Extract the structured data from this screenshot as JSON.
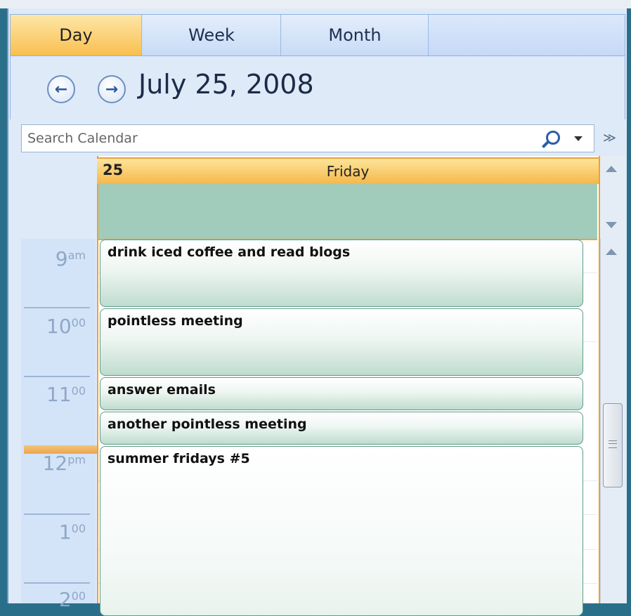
{
  "tabs": [
    {
      "label": "Day",
      "active": true
    },
    {
      "label": "Week",
      "active": false
    },
    {
      "label": "Month",
      "active": false
    }
  ],
  "header": {
    "date_title": "July 25, 2008"
  },
  "search": {
    "placeholder": "Search Calendar"
  },
  "day": {
    "number": "25",
    "name": "Friday"
  },
  "hours": [
    {
      "num": "9",
      "suffix": "am"
    },
    {
      "num": "10",
      "suffix": "00"
    },
    {
      "num": "11",
      "suffix": "00"
    },
    {
      "num": "12",
      "suffix": "pm"
    },
    {
      "num": "1",
      "suffix": "00"
    },
    {
      "num": "2",
      "suffix": "00"
    }
  ],
  "events": [
    {
      "title": "drink iced coffee and read blogs"
    },
    {
      "title": "pointless meeting"
    },
    {
      "title": "answer emails"
    },
    {
      "title": "another pointless meeting"
    },
    {
      "title": "summer fridays #5"
    }
  ],
  "colors": {
    "active_tab": "#f9bf4f",
    "event_border": "#5f9c86",
    "allday_bg": "#a1cbbb",
    "today_border": "#f0a030"
  }
}
